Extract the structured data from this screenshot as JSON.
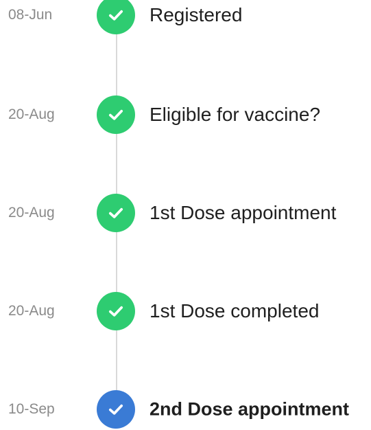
{
  "steps": [
    {
      "date": "08-Jun",
      "label": "Registered",
      "status": "done",
      "icon": "check-icon"
    },
    {
      "date": "20-Aug",
      "label": "Eligible for vaccine?",
      "status": "done",
      "icon": "check-icon"
    },
    {
      "date": "20-Aug",
      "label": "1st Dose appointment",
      "status": "done",
      "icon": "check-icon"
    },
    {
      "date": "20-Aug",
      "label": "1st Dose completed",
      "status": "done",
      "icon": "check-icon"
    },
    {
      "date": "10-Sep",
      "label": "2nd Dose appointment",
      "status": "current",
      "icon": "check-icon"
    }
  ],
  "colors": {
    "done": "#2ecc71",
    "current": "#3a7bd5",
    "date_text": "#8a8a8a",
    "label_text": "#1f1f1f",
    "line": "#d9d9d9"
  }
}
